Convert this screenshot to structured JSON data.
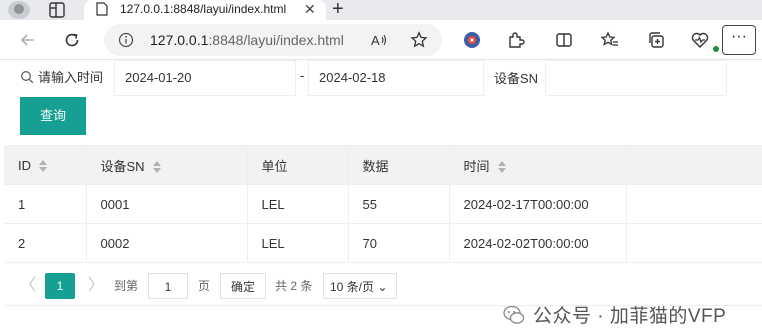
{
  "browser": {
    "tab_title": "127.0.0.1:8848/layui/index.html",
    "url_host": "127.0.0.1",
    "url_rest": ":8848/layui/index.html",
    "icons": [
      "avatar-icon",
      "workspaces-icon",
      "page-icon",
      "close-icon",
      "new-tab-icon",
      "back-icon",
      "reload-icon",
      "info-icon",
      "read-aloud-icon",
      "favorite-star-icon",
      "extension-icon",
      "puzzle-icon",
      "split-screen-icon",
      "favorites-icon",
      "collections-icon",
      "health-icon",
      "more-icon"
    ]
  },
  "search": {
    "label": "请输入时间",
    "start_date": "2024-01-20",
    "separator": "-",
    "end_date": "2024-02-18",
    "sn_label": "设备SN",
    "sn_value": "",
    "query_button": "查询"
  },
  "table": {
    "columns": [
      "ID",
      "设备SN",
      "单位",
      "数据",
      "时间"
    ],
    "rows": [
      [
        "1",
        "0001",
        "LEL",
        "55",
        "2024-02-17T00:00:00"
      ],
      [
        "2",
        "0002",
        "LEL",
        "70",
        "2024-02-02T00:00:00"
      ]
    ]
  },
  "pagination": {
    "prev": "〈",
    "current_page": "1",
    "next": "〉",
    "goto_label": "到第",
    "goto_value": "1",
    "page_unit": "页",
    "confirm": "确定",
    "total": "共 2 条",
    "page_size": "10 条/页"
  },
  "watermark": {
    "text": "公众号 · 加菲猫的VFP"
  },
  "colors": {
    "accent": "#16a093",
    "header_bg": "#f2f2f2",
    "border": "#eeeeee"
  }
}
